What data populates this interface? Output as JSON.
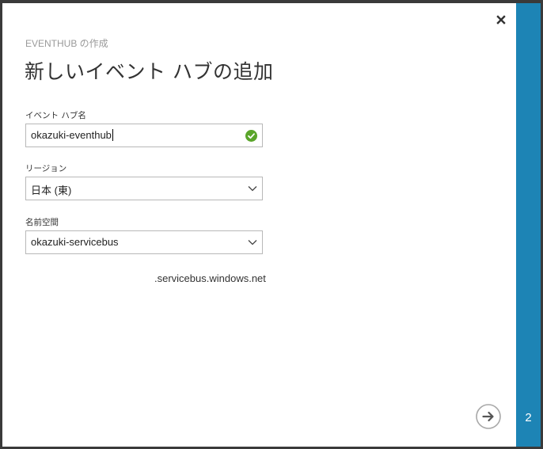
{
  "dialog": {
    "subtitle": "EVENTHUB の作成",
    "title": "新しいイベント ハブの追加"
  },
  "fields": {
    "eventhub_name": {
      "label": "イベント ハブ名",
      "value": "okazuki-eventhub",
      "status": "valid"
    },
    "region": {
      "label": "リージョン",
      "selected": "日本 (東)"
    },
    "namespace": {
      "label": "名前空間",
      "selected": "okazuki-servicebus",
      "suffix": ".servicebus.windows.net"
    }
  },
  "step": {
    "current": "2"
  },
  "icons": {
    "close": "close-icon",
    "valid": "check-circle-icon",
    "dropdown": "chevron-down-icon",
    "next": "arrow-right-circle-icon"
  },
  "colors": {
    "accent": "#1d84b5",
    "valid": "#5aa52a"
  }
}
